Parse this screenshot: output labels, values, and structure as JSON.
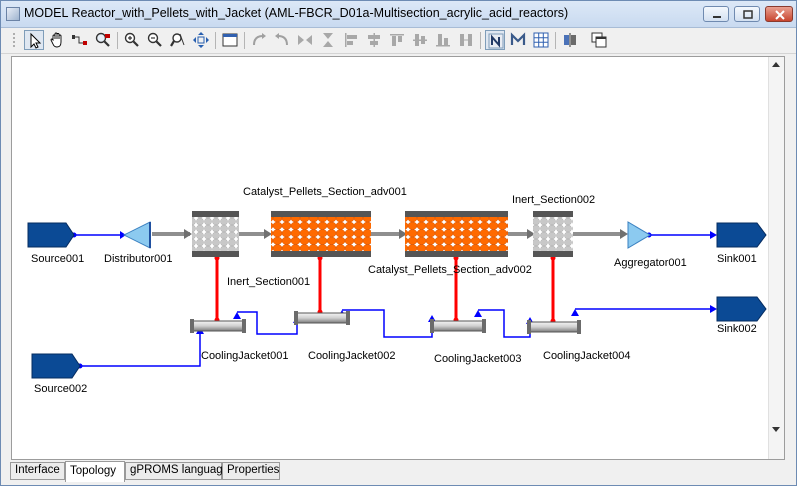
{
  "window": {
    "title": "MODEL Reactor_with_Pellets_with_Jacket (AML-FBCR_D01a-Multisection_acrylic_acid_reactors)"
  },
  "toolbar": {
    "buttons": [
      "select-pointer",
      "pan-hand",
      "connect-tool",
      "zoom-region",
      "zoom-in",
      "zoom-out",
      "zoom-reset",
      "fit-to-window",
      "window-view",
      "rotate-left",
      "rotate-right",
      "flip-horizontal",
      "flip-vertical",
      "align-left",
      "align-center",
      "align-top",
      "align-middle",
      "align-bottom",
      "distribute",
      "show-names",
      "show-models",
      "toggle-grid",
      "split-view",
      "new-window"
    ]
  },
  "diagram": {
    "units": {
      "source001": "Source001",
      "distributor001": "Distributor001",
      "inert_section001": "Inert_Section001",
      "catalyst_adv001": "Catalyst_Pellets_Section_adv001",
      "catalyst_adv002": "Catalyst_Pellets_Section_adv002",
      "inert_section002": "Inert_Section002",
      "aggregator001": "Aggregator001",
      "sink001": "Sink001",
      "sink002": "Sink002",
      "source002": "Source002",
      "coolingjacket001": "CoolingJacket001",
      "coolingjacket002": "CoolingJacket002",
      "coolingjacket003": "CoolingJacket003",
      "coolingjacket004": "CoolingJacket004"
    },
    "colors": {
      "port": "#0b4a95",
      "stream": "#0000ff",
      "heat": "#ff0000",
      "pellet_catalyst": "#ff6a00",
      "pellet_inert": "#c4c4c4",
      "distributor": "#7fbfe8"
    }
  },
  "tabs": {
    "interface": "Interface",
    "topology": "Topology",
    "gproms_language": "gPROMS language",
    "properties": "Properties"
  }
}
